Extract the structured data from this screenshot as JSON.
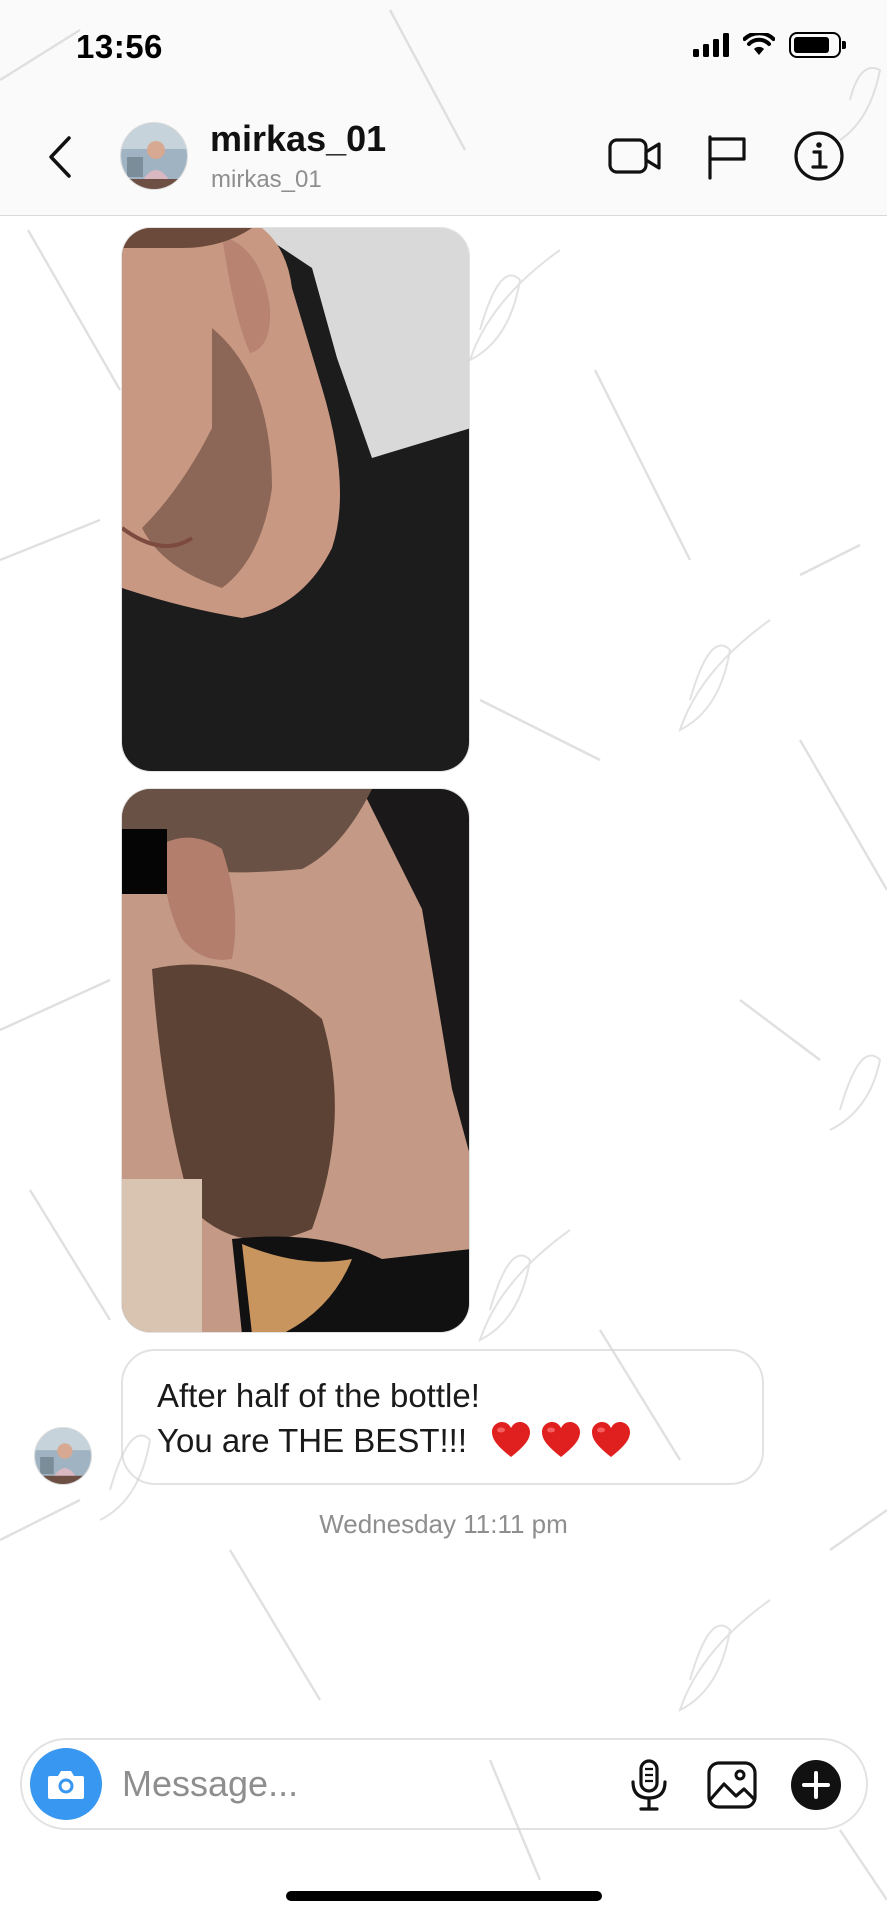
{
  "status_bar": {
    "time": "13:56"
  },
  "header": {
    "title": "mirkas_01",
    "subtitle": "mirkas_01",
    "icons": [
      "chevron-left-icon",
      "video-camera-icon",
      "flag-icon",
      "info-icon"
    ]
  },
  "messages": {
    "photos": [
      {
        "alt": "photo message 1"
      },
      {
        "alt": "photo message 2"
      }
    ],
    "text": {
      "line1": "After half of the bottle!",
      "line2": "You are THE BEST!!!"
    },
    "timestamp": "Wednesday 11:11 pm"
  },
  "composer": {
    "placeholder": "Message...",
    "icons": [
      "camera-icon",
      "microphone-icon",
      "gallery-icon",
      "plus-icon"
    ]
  },
  "colors": {
    "accent": "#3897f0",
    "heart": "#e0201f",
    "header_bg": "#fafafa",
    "muted_text": "#8e8e8e"
  }
}
